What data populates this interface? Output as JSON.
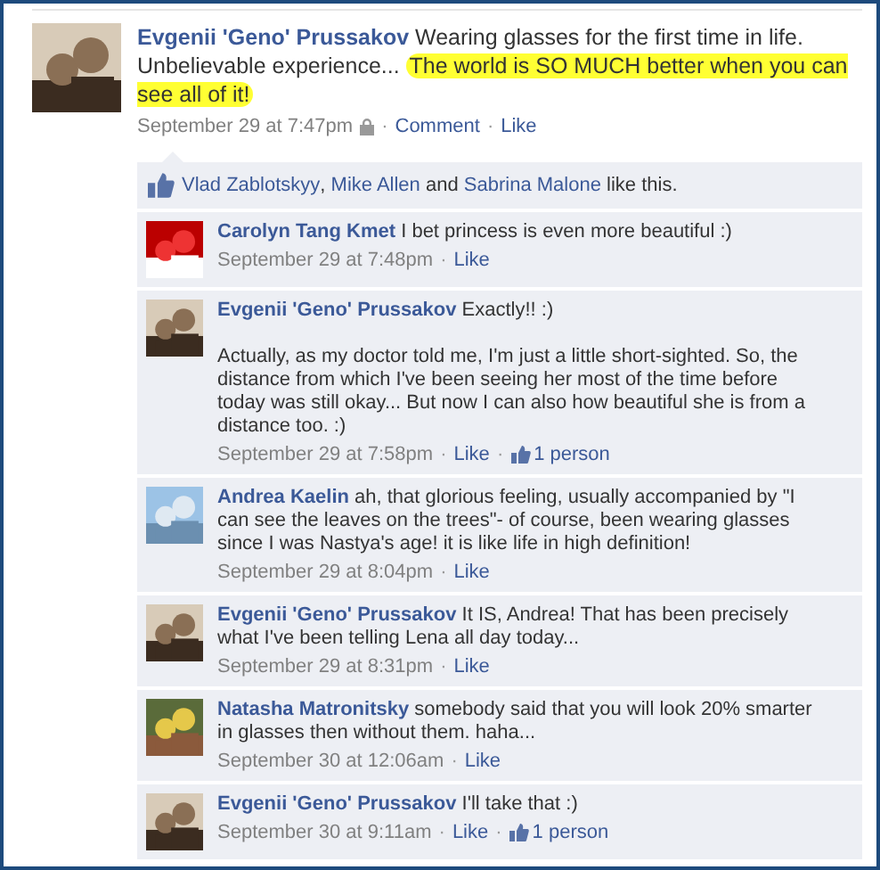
{
  "post": {
    "author": "Evgenii 'Geno' Prussakov",
    "text": "Wearing glasses for the first time in life. Unbelievable experience... ",
    "highlight": "The world is SO MUCH better when you can see all of it!",
    "time": "September 29 at 7:47pm",
    "private": true,
    "actions": [
      "Comment",
      "Like"
    ],
    "separator": "·"
  },
  "likes": {
    "names": [
      "Vlad Zablotskyy",
      "Mike Allen",
      "Sabrina Malone"
    ],
    "separator": ",",
    "conjunction": "and",
    "suffix": "like this."
  },
  "comments": [
    {
      "author": "Carolyn Tang Kmet",
      "paragraphs": [
        "I bet princess is even more beautiful :)"
      ],
      "time": "September 29 at 7:48pm",
      "action": "Like"
    },
    {
      "author": "Evgenii 'Geno' Prussakov",
      "paragraphs": [
        "Exactly!! :)",
        "Actually, as my doctor told me, I'm just a little short-sighted. So, the distance from which I've been seeing her most of the time before today was still okay... But now I can also how beautiful she is from a distance too. :)"
      ],
      "time": "September 29 at 7:58pm",
      "action": "Like",
      "likes": "1 person"
    },
    {
      "author": "Andrea Kaelin",
      "paragraphs": [
        "ah, that glorious feeling, usually accompanied by \"I can see the leaves on the trees\"- of course, been wearing glasses since I was Nastya's age! it is like life in high definition!"
      ],
      "time": "September 29 at 8:04pm",
      "action": "Like"
    },
    {
      "author": "Evgenii 'Geno' Prussakov",
      "paragraphs": [
        "It IS, Andrea! That has been precisely what I've been telling Lena all day today..."
      ],
      "time": "September 29 at 8:31pm",
      "action": "Like"
    },
    {
      "author": "Natasha Matronitsky",
      "paragraphs": [
        "somebody said that you will look 20% smarter in glasses then without them. haha..."
      ],
      "time": "September 30 at 12:06am",
      "action": "Like"
    },
    {
      "author": "Evgenii 'Geno' Prussakov",
      "paragraphs": [
        "I'll take that :)"
      ],
      "time": "September 30 at 9:11am",
      "action": "Like",
      "likes": "1 person"
    }
  ]
}
